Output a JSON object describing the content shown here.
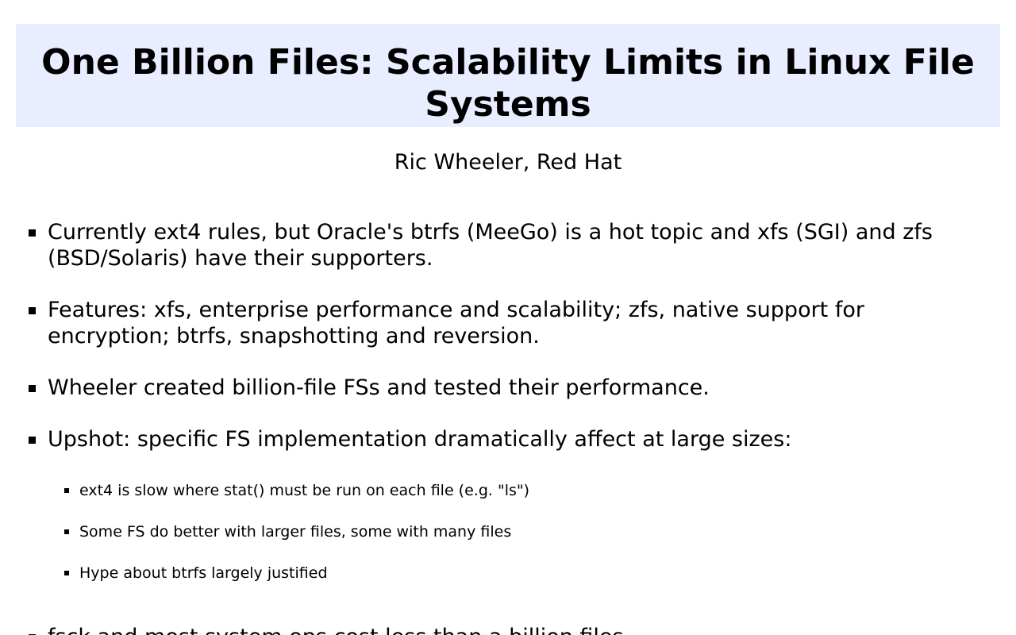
{
  "slide": {
    "title": "One Billion Files: Scalability Limits in Linux File Systems",
    "author": "Ric Wheeler, Red Hat",
    "bullets": [
      "Currently ext4 rules, but Oracle's btrfs (MeeGo) is a hot topic and xfs (SGI) and zfs (BSD/Solaris) have their supporters.",
      "Features: xfs, enterprise performance and scalability; zfs, native support for encryption; btrfs, snapshotting and reversion.",
      "Wheeler created billion-file FSs and tested their performance.",
      "Upshot: specific FS implementation dramatically affect at large sizes:"
    ],
    "sub_bullets": [
      "ext4 is slow where stat() must be run on each file (e.g. \"ls\")",
      "Some FS do better with larger files, some with many files",
      "Hype about btrfs largely justified"
    ],
    "partial_bullet": "fsck and most system ops cost less than a billion files"
  },
  "colors": {
    "title_background": "#e8eeff",
    "text": "#000000",
    "background": "#ffffff"
  }
}
